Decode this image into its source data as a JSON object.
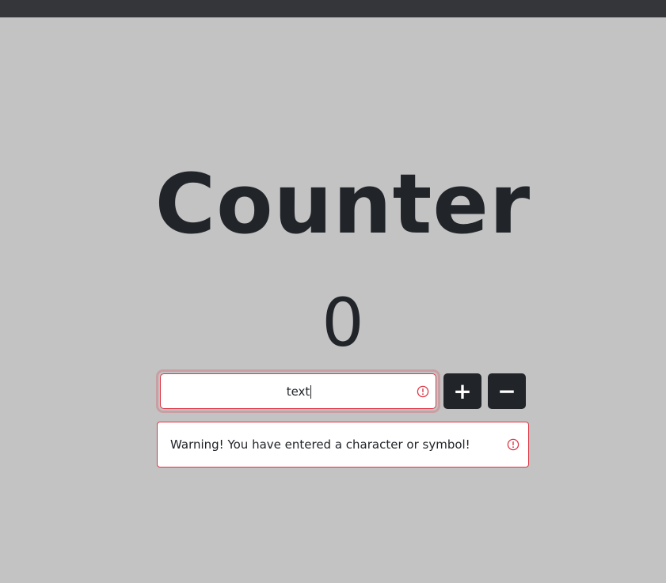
{
  "page": {
    "title": "Counter",
    "count": "0"
  },
  "input": {
    "value": "text",
    "icon": "exclamation-circle-icon",
    "state": "invalid"
  },
  "buttons": {
    "increment_label": "+",
    "decrement_label": "−"
  },
  "warning": {
    "message": "Warning! You have entered a character or symbol!",
    "icon": "exclamation-circle-icon"
  },
  "colors": {
    "background": "#c3c3c3",
    "top_bar": "#35363a",
    "text": "#212529",
    "button": "#212529",
    "danger": "#dc3545"
  }
}
